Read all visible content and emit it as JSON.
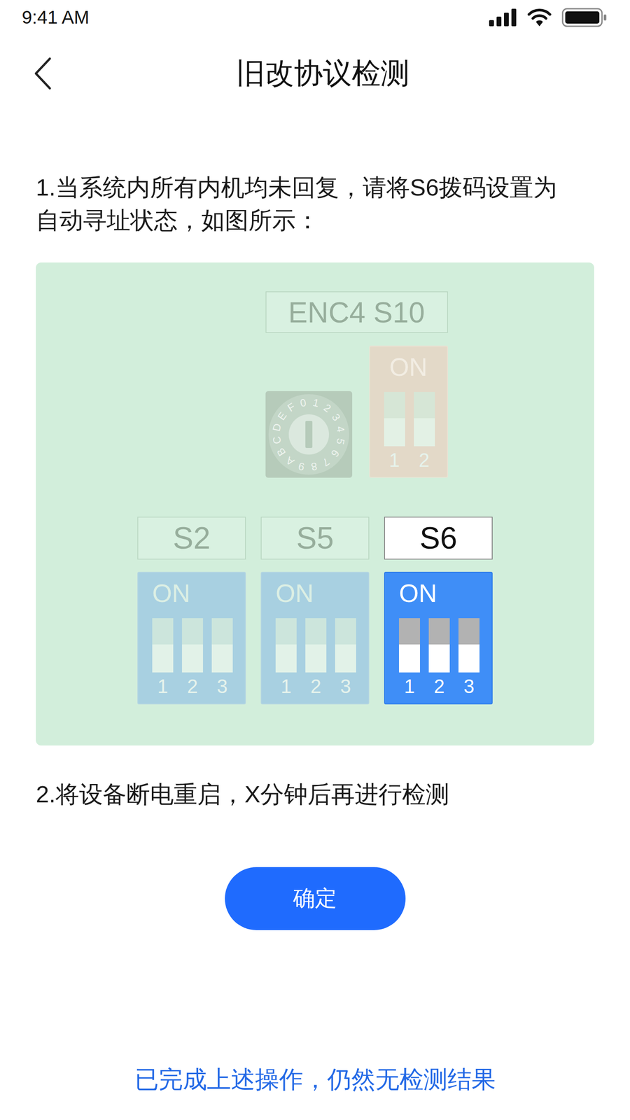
{
  "status_bar": {
    "time": "9:41 AM"
  },
  "nav": {
    "title": "旧改协议检测"
  },
  "steps": [
    "1.当系统内所有内机均未回复，请将S6拨码设置为自动寻址状态，如图所示：",
    "2.将设备断电重启，X分钟后再进行检测"
  ],
  "panel": {
    "top_group": {
      "label": "ENC4 S10",
      "selected": false,
      "rotary": {
        "digits": [
          "0",
          "1",
          "2",
          "3",
          "4",
          "5",
          "6",
          "7",
          "8",
          "9",
          "A",
          "B",
          "C",
          "D",
          "E",
          "F"
        ]
      },
      "switch": {
        "on_label": "ON",
        "switches": [
          {
            "number": "1",
            "on": false
          },
          {
            "number": "2",
            "on": false
          }
        ]
      }
    },
    "switch_groups": [
      {
        "label": "S2",
        "selected": false,
        "on_label": "ON",
        "switches": [
          {
            "number": "1",
            "on": false
          },
          {
            "number": "2",
            "on": false
          },
          {
            "number": "3",
            "on": false
          }
        ]
      },
      {
        "label": "S5",
        "selected": false,
        "on_label": "ON",
        "switches": [
          {
            "number": "1",
            "on": false
          },
          {
            "number": "2",
            "on": false
          },
          {
            "number": "3",
            "on": false
          }
        ]
      },
      {
        "label": "S6",
        "selected": true,
        "on_label": "ON",
        "switches": [
          {
            "number": "1",
            "on": false
          },
          {
            "number": "2",
            "on": false
          },
          {
            "number": "3",
            "on": false
          }
        ]
      }
    ]
  },
  "confirm_button": "确定",
  "help_link": "已完成上述操作，仍然无检测结果"
}
